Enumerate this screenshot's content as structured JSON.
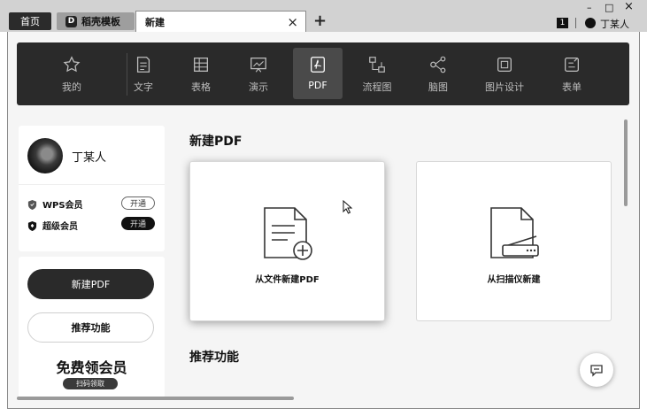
{
  "tabs": {
    "home": "首页",
    "template": "稻壳模板",
    "template_logo": "D",
    "current": "新建",
    "close_glyph": "×",
    "add_glyph": "+"
  },
  "window": {
    "minimize": "–",
    "maximize": "□",
    "close": "×",
    "badge_count": "1",
    "user_name": "丁某人"
  },
  "categories": [
    {
      "label": "我的",
      "icon": "star-icon"
    },
    {
      "label": "文字",
      "icon": "document-icon"
    },
    {
      "label": "表格",
      "icon": "table-icon"
    },
    {
      "label": "演示",
      "icon": "presentation-icon"
    },
    {
      "label": "PDF",
      "icon": "pdf-icon",
      "active": true
    },
    {
      "label": "流程图",
      "icon": "flowchart-icon"
    },
    {
      "label": "脑图",
      "icon": "mindmap-icon"
    },
    {
      "label": "图片设计",
      "icon": "image-design-icon"
    },
    {
      "label": "表单",
      "icon": "form-icon"
    }
  ],
  "profile": {
    "name": "丁某人",
    "wps_vip": "WPS会员",
    "super_vip": "超级会员",
    "open_label": "开通"
  },
  "actions": {
    "new_pdf": "新建PDF",
    "recommend": "推荐功能",
    "promo_title": "免费领会员",
    "promo_button": "扫码领取"
  },
  "main": {
    "title": "新建PDF",
    "from_file": "从文件新建PDF",
    "from_scanner": "从扫描仪新建",
    "section_recommend": "推荐功能"
  },
  "colors": {
    "category_bar": "#2a2a2a",
    "active_category": "#4a4a4a",
    "primary_button": "#2a2a2a"
  }
}
